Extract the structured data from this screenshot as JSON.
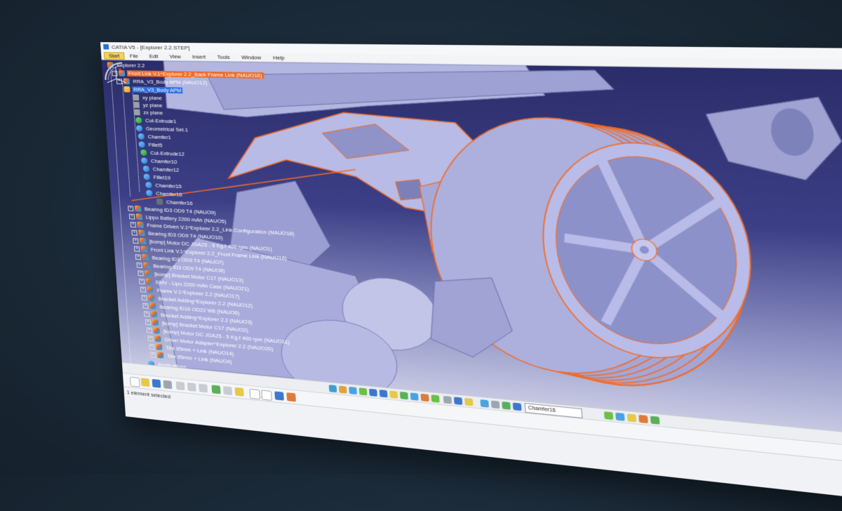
{
  "window": {
    "title": "CATIA V5 - [Explorer 2.2.STEP]",
    "controls": {
      "minimize": "–",
      "maximize": "□",
      "close": "✕"
    }
  },
  "menu": {
    "items": [
      "Start",
      "File",
      "Edit",
      "View",
      "Insert",
      "Tools",
      "Window",
      "Help"
    ]
  },
  "tree": {
    "root": "Explorer 2.2",
    "selected_primary": "Front Link V.1^Explorer 2.2_Back Frame Link (NAUO16)",
    "body_part": "RRA_V3_Body APM (NAUO12)",
    "active_body": "RRA_V3_Body APM",
    "planes": [
      "xy plane",
      "yz plane",
      "zx plane"
    ],
    "features": [
      "Cut-Extrude1",
      "Geometrical Set.1",
      "Chamfer1",
      "Fillet5",
      "Cut-Extrude12",
      "Chamfer10",
      "Chamfer12",
      "Fillet19",
      "Chamfer15",
      "Chamfer16"
    ],
    "sub_feature": "Chamfer16",
    "components": [
      "Bearing ID3 OD9 T4 (NAUO9)",
      "Lippo Battery 2200 mAh (NAUO5)",
      "Frame Driven V.1^Explorer 2.2_Link Configuration (NAUO18)",
      "Bearing ID3 OD9 T4 (NAUO10)",
      "[komp] Motor DC JGA25 - 5 Kg.f 400 rpm (NAUO1)",
      "Front Link V.1^Explorer 2.2_Front Frame Link (NAUO16)",
      "Bearing ID3 OD9 T4 (NAUO7)",
      "Bearing ID3 OD9 T4 (NAUO8)",
      "[komp] Bracket Motor C17 (NAUO13)",
      "EMV - Lipo 2200 mAh Case (NAUO21)",
      "Frame V.1^Explorer 2.2 (NAUO17)",
      "Bracket Adding^Explorer 2.2 (NAUO12)",
      "Bearing ID10 OD22 W6 (NAUO6)",
      "Bracket Adding^Explorer 2.2 (NAUO3)",
      "[komp] Bracket Motor C17 (NAUO2)",
      "[komp] Motor DC JGA25 - 5 Kg.f 400 rpm (NAUO11)",
      "Driver Motor Adapter^Explorer 2.2 (NAUO20)",
      "Tire 85mm + Link (NAUO14)",
      "Tire 85mm + Link (NAUO4)"
    ],
    "applications": "Applications"
  },
  "bottom_toolbar": {
    "command_field": "Chamfer16"
  },
  "status": {
    "text": "1 element selected"
  },
  "colors": {
    "highlight_orange": "#f26a25",
    "selection_blue": "#2c6fe0",
    "part_fill": "#a9acdb",
    "background_top": "#2b2d6a"
  }
}
